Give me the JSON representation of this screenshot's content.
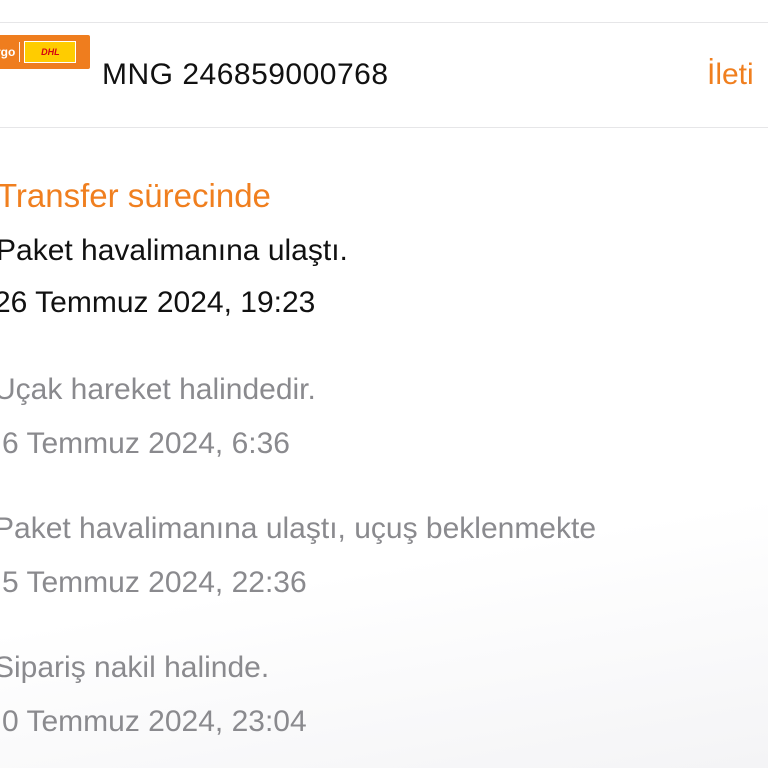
{
  "header": {
    "carrier_logo_left_text": "rgo",
    "carrier_logo_dhl_text": "DHL",
    "tracking_number": "MNG 246859000768",
    "contact_label": "İleti"
  },
  "status": {
    "title": "Transfer sürecinde"
  },
  "events": [
    {
      "description": "Paket havalimanına ulaştı.",
      "date": "26 Temmuz 2024, 19:23",
      "current": true
    },
    {
      "description": "Uçak hareket halindedir.",
      "date": "6 Temmuz 2024, 6:36",
      "current": false
    },
    {
      "description": "Paket havalimanına ulaştı, uçuş beklenmekte",
      "date": "5 Temmuz 2024, 22:36",
      "current": false
    },
    {
      "description": "Sipariş nakil halinde.",
      "date": "0 Temmuz 2024, 23:04",
      "current": false
    }
  ],
  "colors": {
    "accent": "#f07f1f",
    "primary_text": "#111111",
    "secondary_text": "#8a8a8e",
    "dhl_yellow": "#ffcc00",
    "dhl_red": "#d40511"
  }
}
